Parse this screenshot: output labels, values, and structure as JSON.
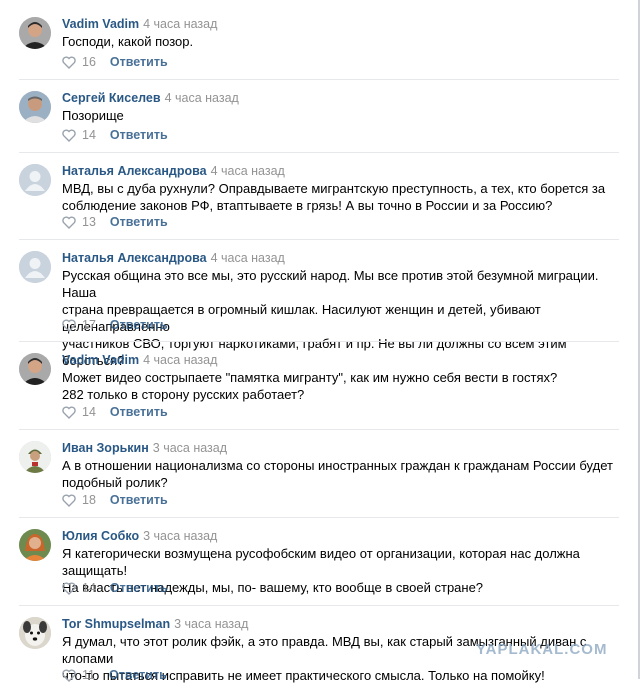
{
  "comments": [
    {
      "author": "Vadim Vadim",
      "time": "4 часа назад",
      "text": "Господи, какой позор.",
      "likes": "16",
      "reply": "Ответить",
      "avatar": "man-dark-icon"
    },
    {
      "author": "Сергей Киселев",
      "time": "4 часа назад",
      "text": "Позорище",
      "likes": "14",
      "reply": "Ответить",
      "avatar": "man-gray-icon"
    },
    {
      "author": "Наталья Александрова",
      "time": "4 часа назад",
      "text": "МВД, вы с дуба рухнули? Оправдываете мигрантскую преступность, а тех, кто борется за\nсоблюдение законов РФ, втаптываете в грязь! А вы точно в России и за Россию?",
      "likes": "13",
      "reply": "Ответить",
      "avatar": "default-user-icon"
    },
    {
      "author": "Наталья Александрова",
      "time": "4 часа назад",
      "text": "Русская община это все мы, это русский народ. Мы все против этой безумной миграции. Наша\nстрана превращается в огромный кишлак. Насилуют женщин и детей, убивают целенаправленно\nучастников СВО, торгуют наркотиками, грабят и пр. Не вы ли должны со всем этим бороться?",
      "likes": "17",
      "reply": "Ответить",
      "avatar": "default-user-icon"
    },
    {
      "author": "Vadim Vadim",
      "time": "4 часа назад",
      "text": "Может видео сострыпаете \"памятка мигранту\", как им нужно себя вести в гостях?\n282 только в сторону русских работает?",
      "likes": "14",
      "reply": "Ответить",
      "avatar": "man-dark-icon"
    },
    {
      "author": "Иван Зорькин",
      "time": "3 часа назад",
      "text": "А в отношении национализма со стороны иностранных граждан к гражданам России будет\nподобный ролик?",
      "likes": "18",
      "reply": "Ответить",
      "avatar": "soldier-icon"
    },
    {
      "author": "Юлия Собко",
      "time": "3 часа назад",
      "text": "Я категорически возмущена русофобским видео от организации, которая нас должна защищать!\nНа власть нет надежды, мы, по- вашему, кто вообще в своей стране?",
      "likes": "14",
      "reply": "Ответить",
      "avatar": "woman-icon"
    },
    {
      "author": "Tor Shmupselman",
      "time": "3 часа назад",
      "text": "Я думал, что этот ролик фэйк, а это правда. МВД вы, как старый замызганный диван с клопами\nчто-то пытаться исправить не имеет практического смысла. Только на помойку!",
      "likes": "11",
      "reply": "Ответить",
      "avatar": "dog-icon"
    }
  ],
  "watermark": "YAPLAKAL.COM",
  "colors": {
    "link": "#2a5885",
    "muted": "#939393",
    "separator": "#e7e8ec"
  }
}
